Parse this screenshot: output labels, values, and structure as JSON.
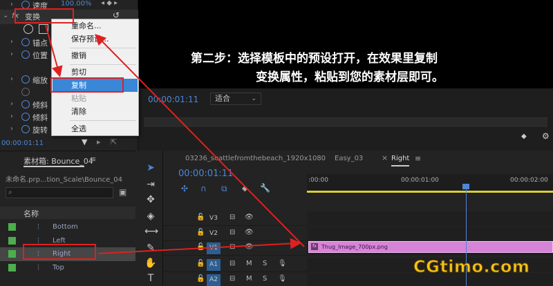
{
  "effects": {
    "rows": [
      {
        "label": "速度",
        "value": "100.00%"
      },
      {
        "label": "变换"
      },
      {
        "label": "锚点"
      },
      {
        "label": "位置"
      },
      {
        "label": "缩放"
      },
      {
        "label": "倾斜"
      },
      {
        "label": "倾斜"
      },
      {
        "label": "旋转"
      }
    ],
    "fx_label": "fx",
    "timecode": "00:00:01:11"
  },
  "context_menu": {
    "items": [
      "重命名...",
      "保存预设...",
      "撤销",
      "剪切",
      "复制",
      "粘贴",
      "清除",
      "全选"
    ],
    "selected": "复制",
    "disabled": [
      "粘贴"
    ]
  },
  "monitor": {
    "timecode": "00:00:01:11",
    "fit": "适合"
  },
  "annotation": {
    "line1": "第二步：选择模板中的预设打开，在效果里复制",
    "line2": "变换属性，粘贴到您的素材层即可。"
  },
  "project": {
    "tab": "素材箱: Bounce_04",
    "path": "未命名.prp...tion_Scale\\Bounce_04",
    "column": "名称",
    "items": [
      "Bottom",
      "Left",
      "Right",
      "Top"
    ],
    "swatch_color": "#4cae4c"
  },
  "timeline": {
    "tabs": [
      "03236_seattlefromthebeach_1920x1080",
      "Easy_03",
      "Right"
    ],
    "close_mark": "×",
    "menu_mark": "≡",
    "timecode": "00:00:01:11",
    "ruler": [
      ":00:00",
      "00:00:01:00",
      "00:00:02:00"
    ],
    "tracks": [
      "V3",
      "V2",
      "V1",
      "A1",
      "A2"
    ],
    "track_icons": {
      "m": "M",
      "s": "S"
    },
    "clip_name": "Thug_Image_700px.png",
    "clip_fx": "fx",
    "clip_color": "#d684d8"
  },
  "watermark": "CGtimo.com"
}
